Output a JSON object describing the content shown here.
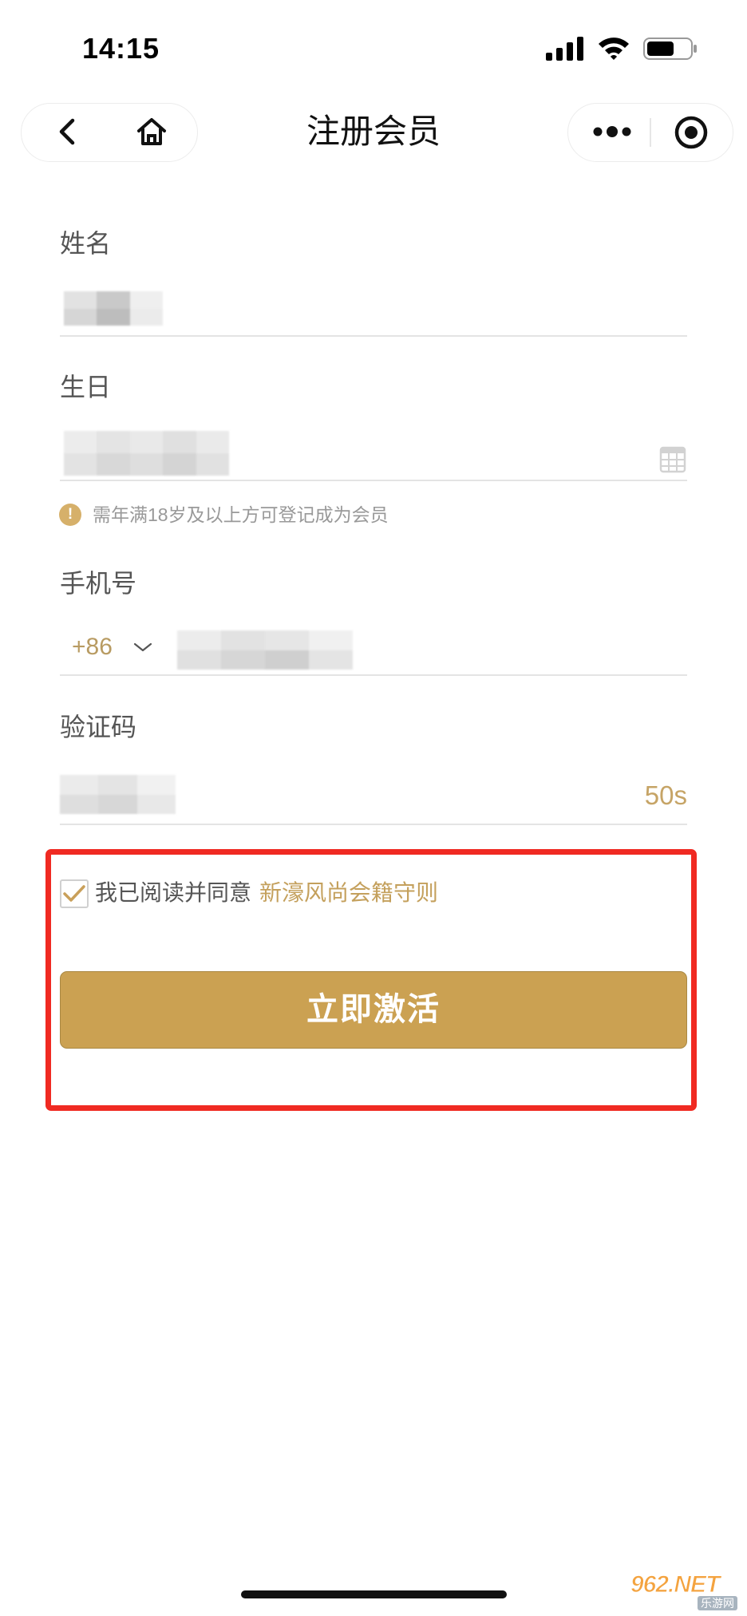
{
  "status_bar": {
    "time": "14:15",
    "icons": [
      "signal-icon",
      "wifi-icon",
      "battery-icon"
    ]
  },
  "nav": {
    "title": "注册会员",
    "left_icons": [
      "back-chevron-icon",
      "home-icon"
    ],
    "right_icons": [
      "more-dots-icon",
      "target-icon"
    ]
  },
  "form": {
    "name": {
      "label": "姓名"
    },
    "birthday": {
      "label": "生日",
      "hint": "需年满18岁及以上方可登记成为会员",
      "hint_icon": "exclamation-icon",
      "picker_icon": "calendar-icon"
    },
    "phone": {
      "label": "手机号",
      "country_code": "+86",
      "dropdown_icon": "chevron-down-icon"
    },
    "code": {
      "label": "验证码",
      "countdown": "50s"
    }
  },
  "agreement": {
    "checked": true,
    "prefix": "我已阅读并同意",
    "link": "新濠风尚会籍守则"
  },
  "submit": {
    "label": "立即激活"
  },
  "watermark": {
    "text": "962.NET",
    "subtext": "乐游网"
  },
  "colors": {
    "accent": "#C4A05C",
    "button": "#CBA152",
    "highlight_border": "#F02A22",
    "label": "#555555",
    "hint": "#999999"
  }
}
